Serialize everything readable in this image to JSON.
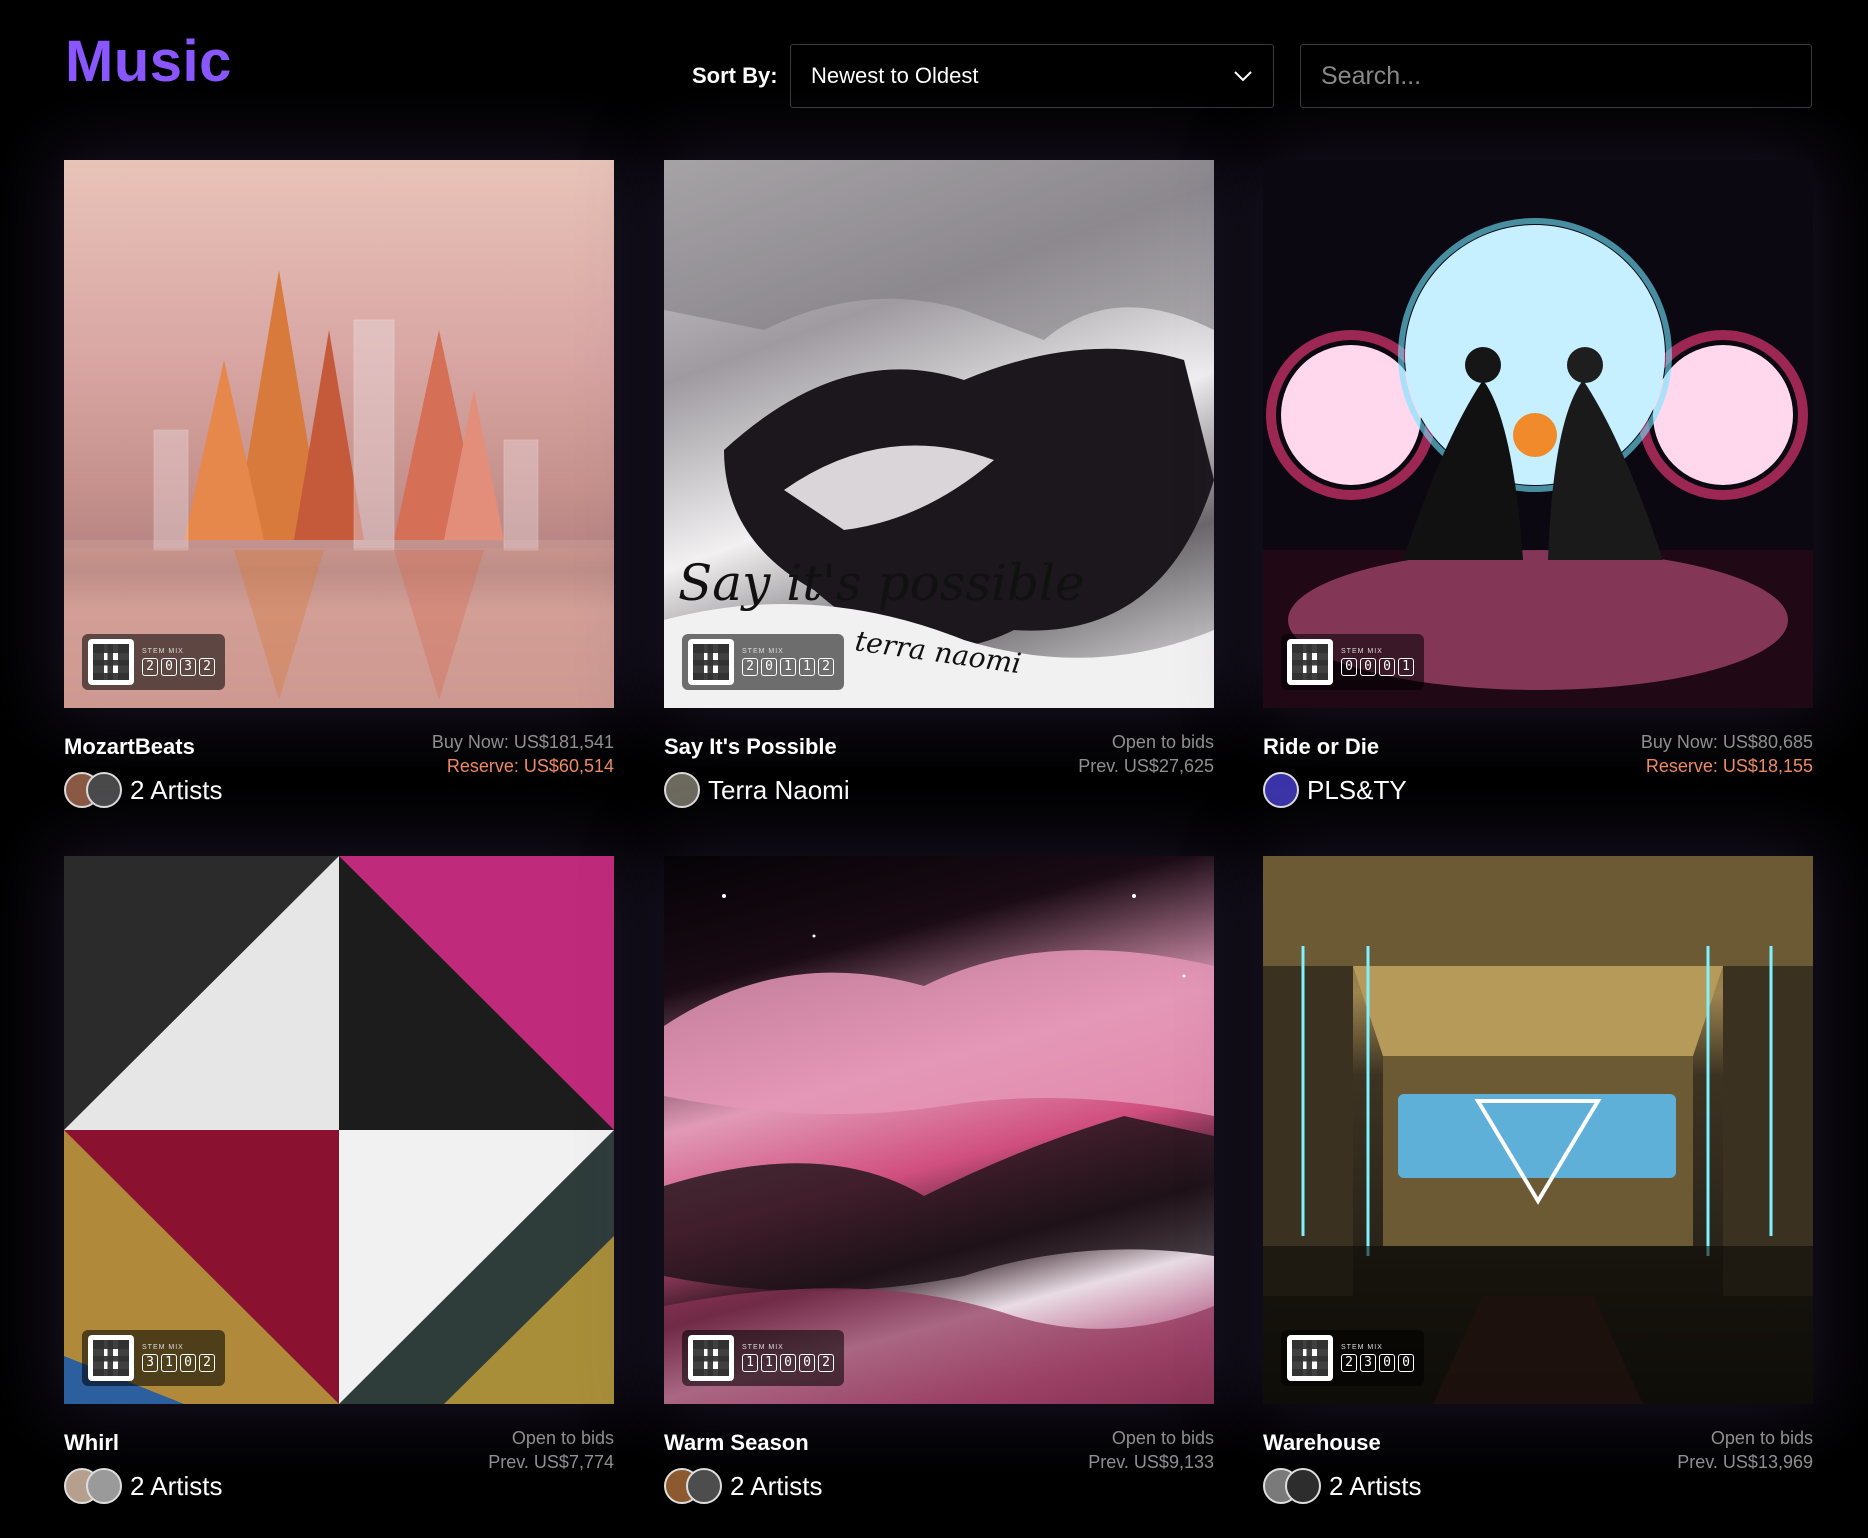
{
  "header": {
    "title": "Music",
    "sort_label": "Sort By:",
    "sort_value": "Newest to Oldest",
    "search_placeholder": "Search..."
  },
  "items": [
    {
      "name": "MozartBeats",
      "artists": "2 Artists",
      "price_line1": "Buy Now: US$181,541",
      "price_line2": "Reserve: US$60,514",
      "badge_label": "STEM MIX",
      "badge_digits": [
        "2",
        "0",
        "3",
        "2"
      ]
    },
    {
      "name": "Say It's Possible",
      "artists": "Terra Naomi",
      "price_line1": "Open to bids",
      "price_line2": "Prev. US$27,625",
      "badge_label": "STEM MIX",
      "badge_digits": [
        "2",
        "0",
        "1",
        "1",
        "2"
      ],
      "art_text_1": "Say it's possible",
      "art_text_2": "terra naomi"
    },
    {
      "name": "Ride or Die",
      "artists": "PLS&TY",
      "price_line1": "Buy Now: US$80,685",
      "price_line2": "Reserve: US$18,155",
      "badge_label": "STEM MIX",
      "badge_digits": [
        "0",
        "0",
        "0",
        "1"
      ]
    },
    {
      "name": "Whirl",
      "artists": "2 Artists",
      "price_line1": "Open to bids",
      "price_line2": "Prev. US$7,774",
      "badge_label": "STEM MIX",
      "badge_digits": [
        "3",
        "1",
        "0",
        "2"
      ]
    },
    {
      "name": "Warm Season",
      "artists": "2 Artists",
      "price_line1": "Open to bids",
      "price_line2": "Prev. US$9,133",
      "badge_label": "STEM MIX",
      "badge_digits": [
        "1",
        "1",
        "0",
        "0",
        "2"
      ]
    },
    {
      "name": "Warehouse",
      "artists": "2 Artists",
      "price_line1": "Open to bids",
      "price_line2": "Prev. US$13,969",
      "badge_label": "STEM MIX",
      "badge_digits": [
        "2",
        "3",
        "0",
        "0"
      ]
    }
  ],
  "colors": {
    "title": "#8a57ff",
    "reserve": "#f08a62",
    "muted": "#8f8f8f"
  },
  "icons": {
    "sort_chevron": "chevron-down-icon"
  }
}
